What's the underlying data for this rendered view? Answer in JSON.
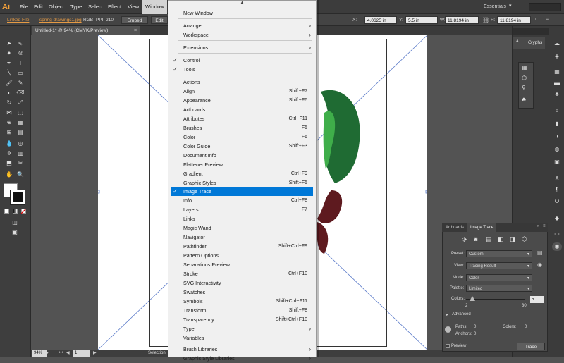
{
  "app": {
    "logo": "Ai"
  },
  "menubar": {
    "items": [
      "File",
      "Edit",
      "Object",
      "Type",
      "Select",
      "Effect",
      "View",
      "Window"
    ],
    "active": "Window",
    "workspace": "Essentials"
  },
  "control_bar": {
    "linked_file": "Linked File",
    "filename": "spring drawings1.jpg",
    "color_mode": "RGB",
    "ppi_label": "PPI: 210",
    "embed_button": "Embed",
    "edit_button": "Edit",
    "x_label": "X:",
    "x_value": "4.0625 in",
    "y_label": "Y:",
    "y_value": "5.5 in",
    "w_label": "W:",
    "w_value": "11.8194 in",
    "h_label": "H:",
    "h_value": "11.8194 in"
  },
  "document_tab": {
    "title": "Untitled-1* @ 94% (CMYK/Preview)",
    "close": "×"
  },
  "status_bar": {
    "zoom": "94%",
    "page": "1",
    "tool": "Selection"
  },
  "right_panels": {
    "glyphs": "Glyphs"
  },
  "window_menu": {
    "items": [
      {
        "label": "New Window",
        "shortcut": "",
        "submenu": false,
        "checked": false
      },
      {
        "label": "Arrange",
        "shortcut": "",
        "submenu": true,
        "checked": false
      },
      {
        "label": "Workspace",
        "shortcut": "",
        "submenu": true,
        "checked": false
      },
      {
        "label": "Extensions",
        "shortcut": "",
        "submenu": true,
        "checked": false
      },
      {
        "label": "Control",
        "shortcut": "",
        "submenu": false,
        "checked": true
      },
      {
        "label": "Tools",
        "shortcut": "",
        "submenu": false,
        "checked": true
      },
      {
        "label": "Actions",
        "shortcut": "",
        "submenu": false,
        "checked": false
      },
      {
        "label": "Align",
        "shortcut": "Shift+F7",
        "submenu": false,
        "checked": false
      },
      {
        "label": "Appearance",
        "shortcut": "Shift+F6",
        "submenu": false,
        "checked": false
      },
      {
        "label": "Artboards",
        "shortcut": "",
        "submenu": false,
        "checked": false
      },
      {
        "label": "Attributes",
        "shortcut": "Ctrl+F11",
        "submenu": false,
        "checked": false
      },
      {
        "label": "Brushes",
        "shortcut": "F5",
        "submenu": false,
        "checked": false
      },
      {
        "label": "Color",
        "shortcut": "F6",
        "submenu": false,
        "checked": false
      },
      {
        "label": "Color Guide",
        "shortcut": "Shift+F3",
        "submenu": false,
        "checked": false
      },
      {
        "label": "Document Info",
        "shortcut": "",
        "submenu": false,
        "checked": false
      },
      {
        "label": "Flattener Preview",
        "shortcut": "",
        "submenu": false,
        "checked": false
      },
      {
        "label": "Gradient",
        "shortcut": "Ctrl+F9",
        "submenu": false,
        "checked": false
      },
      {
        "label": "Graphic Styles",
        "shortcut": "Shift+F5",
        "submenu": false,
        "checked": false
      },
      {
        "label": "Image Trace",
        "shortcut": "",
        "submenu": false,
        "checked": true,
        "highlighted": true
      },
      {
        "label": "Info",
        "shortcut": "Ctrl+F8",
        "submenu": false,
        "checked": false
      },
      {
        "label": "Layers",
        "shortcut": "F7",
        "submenu": false,
        "checked": false
      },
      {
        "label": "Links",
        "shortcut": "",
        "submenu": false,
        "checked": false
      },
      {
        "label": "Magic Wand",
        "shortcut": "",
        "submenu": false,
        "checked": false
      },
      {
        "label": "Navigator",
        "shortcut": "",
        "submenu": false,
        "checked": false
      },
      {
        "label": "Pathfinder",
        "shortcut": "Shift+Ctrl+F9",
        "submenu": false,
        "checked": false
      },
      {
        "label": "Pattern Options",
        "shortcut": "",
        "submenu": false,
        "checked": false
      },
      {
        "label": "Separations Preview",
        "shortcut": "",
        "submenu": false,
        "checked": false
      },
      {
        "label": "Stroke",
        "shortcut": "Ctrl+F10",
        "submenu": false,
        "checked": false
      },
      {
        "label": "SVG Interactivity",
        "shortcut": "",
        "submenu": false,
        "checked": false
      },
      {
        "label": "Swatches",
        "shortcut": "",
        "submenu": false,
        "checked": false
      },
      {
        "label": "Symbols",
        "shortcut": "Shift+Ctrl+F11",
        "submenu": false,
        "checked": false
      },
      {
        "label": "Transform",
        "shortcut": "Shift+F8",
        "submenu": false,
        "checked": false
      },
      {
        "label": "Transparency",
        "shortcut": "Shift+Ctrl+F10",
        "submenu": false,
        "checked": false
      },
      {
        "label": "Type",
        "shortcut": "",
        "submenu": true,
        "checked": false
      },
      {
        "label": "Variables",
        "shortcut": "",
        "submenu": false,
        "checked": false
      },
      {
        "label": "Brush Libraries",
        "shortcut": "",
        "submenu": true,
        "checked": false
      },
      {
        "label": "Graphic Style Libraries",
        "shortcut": "",
        "submenu": true,
        "checked": false
      }
    ],
    "checkmark": "✓",
    "submenu_arrow": "›",
    "scroll_up": "▲"
  },
  "image_trace_panel": {
    "tabs": [
      "Artboards",
      "Image Trace"
    ],
    "active_tab": "Image Trace",
    "preset_label": "Preset:",
    "preset_value": "Custom",
    "view_label": "View:",
    "view_value": "Tracing Result",
    "mode_label": "Mode:",
    "mode_value": "Color",
    "palette_label": "Palette:",
    "palette_value": "Limited",
    "colors_label": "Colors:",
    "colors_value": "5",
    "colors_min": "2",
    "colors_max": "30",
    "colors_slider_fraction": 0.107,
    "advanced_label": "Advanced",
    "paths_label": "Paths:",
    "paths_value": "0",
    "anchors_label": "Anchors:",
    "anchors_value": "0",
    "colors_count_label": "Colors:",
    "colors_count_value": "0",
    "preview_label": "Preview",
    "trace_button": "Trace"
  },
  "colors": {
    "leaf_dark": "#1f6b33",
    "leaf_light": "#3fae4a",
    "berry": "#5e1a1f",
    "highlight": "#0078d7",
    "accent_orange": "#e59a44"
  }
}
